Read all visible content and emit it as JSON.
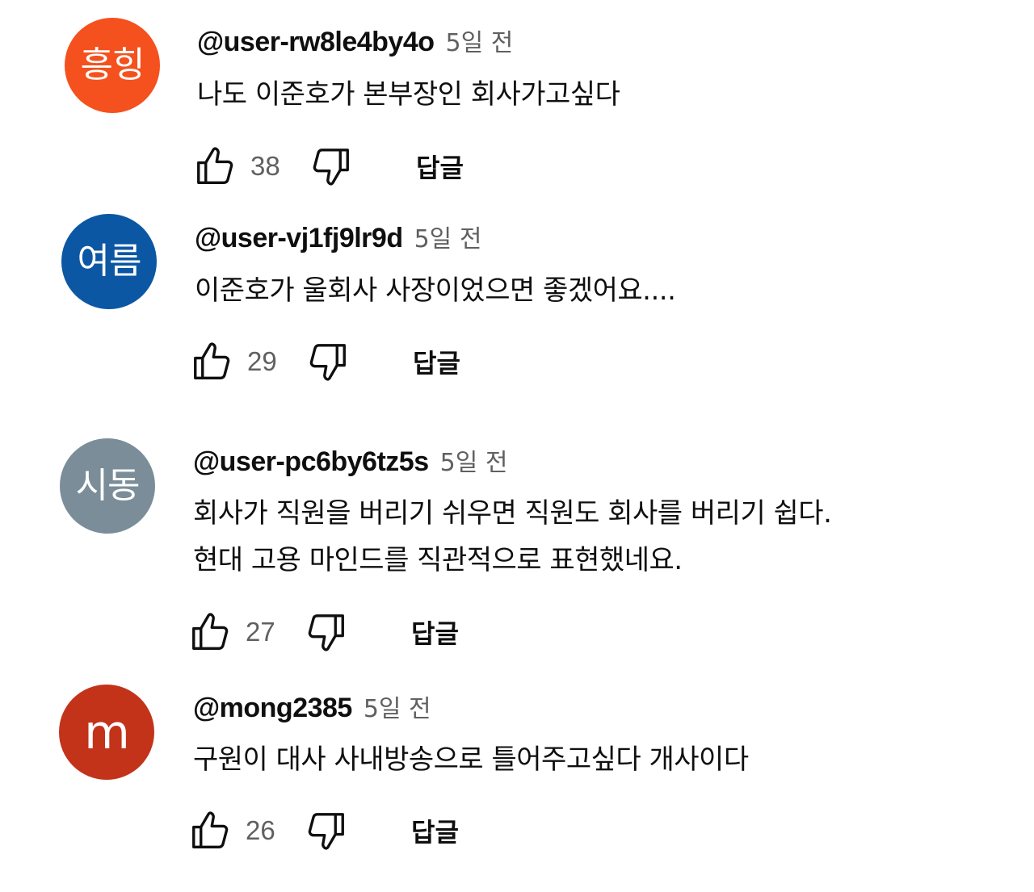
{
  "comments": [
    {
      "avatar_text": "흥힝",
      "avatar_color": "#f4511e",
      "author": "@user-rw8le4by4o",
      "time": "5일 전",
      "lines": [
        "나도 이준호가 본부장인 회사가고싶다"
      ],
      "likes": "38",
      "reply_label": "답글"
    },
    {
      "avatar_text": "여름",
      "avatar_color": "#0b57a4",
      "author": "@user-vj1fj9lr9d",
      "time": "5일 전",
      "lines": [
        "이준호가 울회사 사장이었으면 좋겠어요...."
      ],
      "likes": "29",
      "reply_label": "답글"
    },
    {
      "avatar_text": "시동",
      "avatar_color": "#7a8d99",
      "author": "@user-pc6by6tz5s",
      "time": "5일 전",
      "lines": [
        "회사가 직원을 버리기 쉬우면 직원도 회사를 버리기 쉽다.",
        "현대 고용 마인드를 직관적으로 표현했네요."
      ],
      "likes": "27",
      "reply_label": "답글"
    },
    {
      "avatar_text": "m",
      "avatar_color": "#c2331a",
      "author": "@mong2385",
      "time": "5일 전",
      "lines": [
        "구원이 대사 사내방송으로 틀어주고싶다 개사이다"
      ],
      "likes": "26",
      "reply_label": "답글"
    }
  ],
  "icons": {
    "like": "thumbs-up-icon",
    "dislike": "thumbs-down-icon"
  }
}
